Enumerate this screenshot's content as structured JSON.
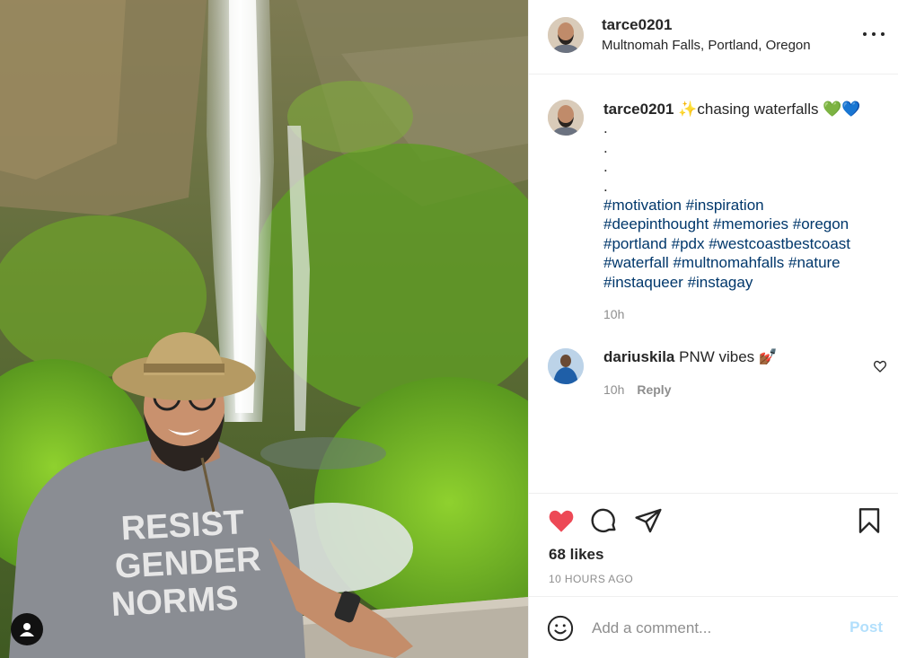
{
  "post": {
    "username": "tarce0201",
    "location": "Multnomah Falls, Portland, Oregon",
    "caption": {
      "username": "tarce0201",
      "text": "✨chasing waterfalls 💚💙",
      "dots": [
        ".",
        ".",
        ".",
        "."
      ],
      "hashtag_lines": [
        "#motivation #inspiration",
        "#deepinthought #memories #oregon",
        "#portland #pdx #westcoastbestcoast",
        "#waterfall #multnomahfalls #nature",
        "#instaqueer #instagay"
      ],
      "time": "10h"
    },
    "comments": [
      {
        "username": "dariuskila",
        "text": "PNW vibes 💅🏾",
        "time": "10h",
        "reply_label": "Reply"
      }
    ],
    "likes": "68 likes",
    "time_ago": "10 HOURS AGO",
    "add_comment_placeholder": "Add a comment...",
    "post_label": "Post",
    "photo_text": {
      "shirt_line1": "RESIST",
      "shirt_line2": "GENDER",
      "shirt_line3": "NORMS"
    }
  },
  "colors": {
    "like_red": "#ed4956",
    "hashtag_blue": "#00376b",
    "post_disabled": "#b2dffc",
    "muted_gray": "#8e8e8e"
  },
  "icons": [
    "more-options-icon",
    "heart-icon",
    "comment-icon",
    "share-icon",
    "bookmark-icon",
    "emoji-icon",
    "user-tag-icon",
    "heart-outline-icon"
  ]
}
